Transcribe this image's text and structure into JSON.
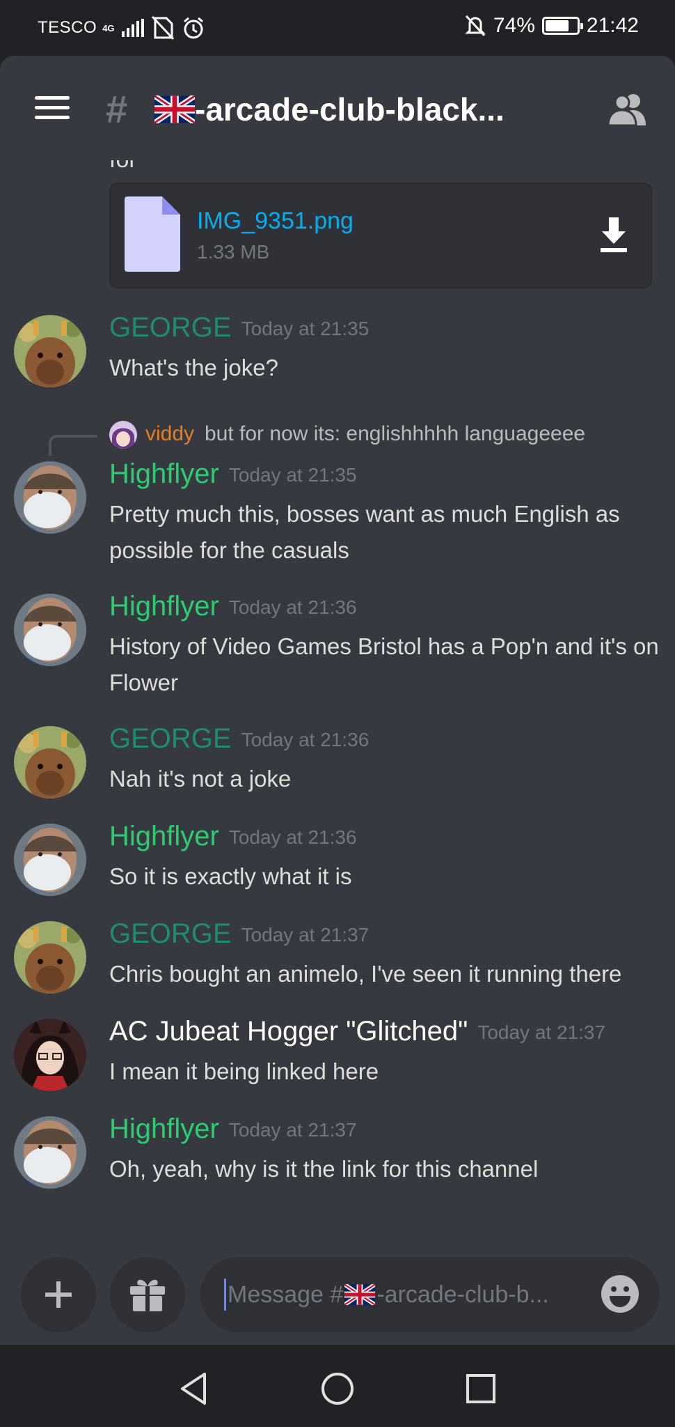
{
  "status_bar": {
    "carrier": "TESCO",
    "network": "4G",
    "battery": "74%",
    "time": "21:42",
    "battery_level": 0.74
  },
  "header": {
    "channel_prefix": "#",
    "channel_name": "-arcade-club-black...",
    "flag": "uk-flag"
  },
  "chat": {
    "cut_off_text": "for",
    "attachment": {
      "file_name": "IMG_9351.png",
      "file_size": "1.33 MB"
    },
    "messages": [
      {
        "author": "GEORGE",
        "author_color": "#1f8b6f",
        "time": "Today at 21:35",
        "text": "What's the joke?"
      },
      {
        "reply_to": {
          "author": "viddy",
          "text": "but for now its: englishhhhh languageeee"
        },
        "author": "Highflyer",
        "author_color": "#2ecc71",
        "time": "Today at 21:35",
        "text": "Pretty much this, bosses want as much English as possible for the casuals"
      },
      {
        "author": "Highflyer",
        "author_color": "#2ecc71",
        "time": "Today at 21:36",
        "text": "History of Video Games Bristol has a Pop'n and it's on Flower"
      },
      {
        "author": "GEORGE",
        "author_color": "#1f8b6f",
        "time": "Today at 21:36",
        "text": "Nah it's not a joke"
      },
      {
        "author": "Highflyer",
        "author_color": "#2ecc71",
        "time": "Today at 21:36",
        "text": "So it is exactly what it is"
      },
      {
        "author": "GEORGE",
        "author_color": "#1f8b6f",
        "time": "Today at 21:37",
        "text": "Chris bought an animelo, I've seen it running there"
      },
      {
        "author": "AC Jubeat Hogger \"Glitched\"",
        "author_color": "#ffffff",
        "time": "Today at 21:37",
        "text": "I mean it being linked here"
      },
      {
        "author": "Highflyer",
        "author_color": "#2ecc71",
        "time": "Today at 21:37",
        "text": "Oh, yeah, why is it the link for this channel"
      }
    ]
  },
  "composer": {
    "placeholder_prefix": "Message #",
    "placeholder_suffix": "-arcade-club-b..."
  },
  "colors": {
    "background": "#36393f",
    "header": "#36393f",
    "dark": "#202225",
    "link": "#00aff4",
    "muted": "#72767d"
  }
}
